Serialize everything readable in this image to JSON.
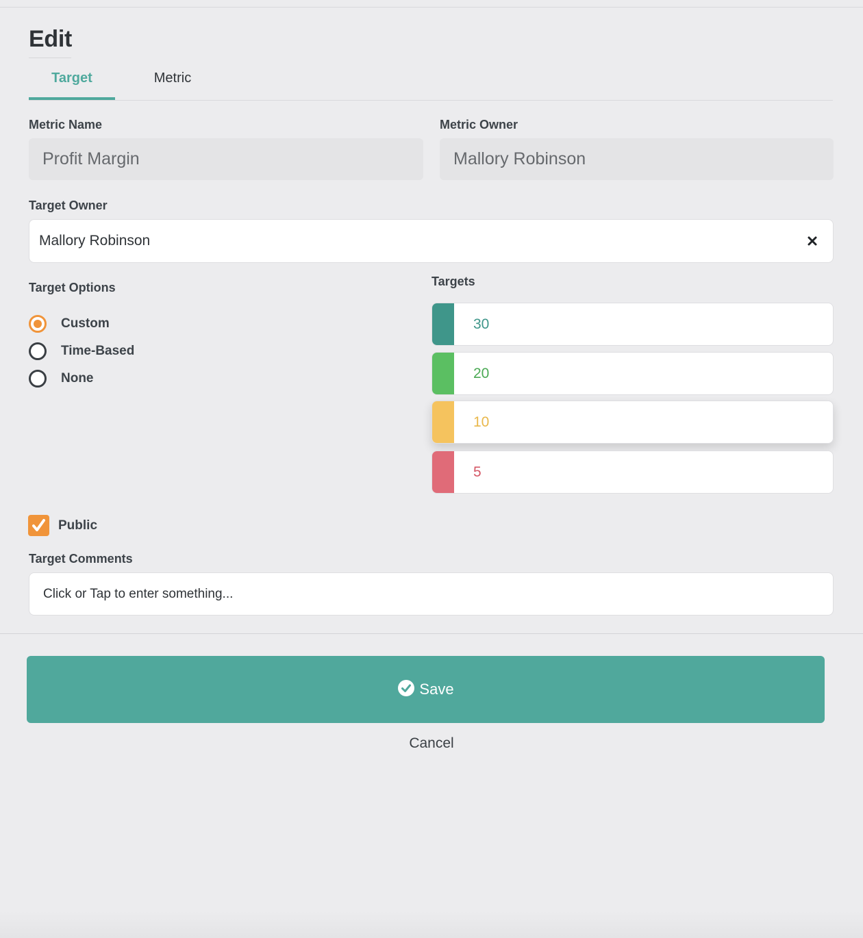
{
  "page": {
    "title": "Edit"
  },
  "tabs": [
    {
      "label": "Target",
      "active": true
    },
    {
      "label": "Metric",
      "active": false
    }
  ],
  "metric_name": {
    "label": "Metric Name",
    "value": "Profit Margin"
  },
  "metric_owner": {
    "label": "Metric Owner",
    "value": "Mallory Robinson"
  },
  "target_owner": {
    "label": "Target Owner",
    "value": "Mallory Robinson",
    "clear_icon": "close-icon"
  },
  "target_options": {
    "label": "Target Options",
    "options": [
      {
        "label": "Custom",
        "checked": true
      },
      {
        "label": "Time-Based",
        "checked": false
      },
      {
        "label": "None",
        "checked": false
      }
    ],
    "accent_color": "#f0943a"
  },
  "targets": {
    "label": "Targets",
    "items": [
      {
        "value": "30",
        "color": "#3f968a",
        "text_color": "#3f968a"
      },
      {
        "value": "20",
        "color": "#5bbf62",
        "text_color": "#4caa55"
      },
      {
        "value": "10",
        "color": "#f5c35e",
        "text_color": "#e9b84c"
      },
      {
        "value": "5",
        "color": "#e06b78",
        "text_color": "#d45766"
      }
    ]
  },
  "public": {
    "label": "Public",
    "checked": true
  },
  "target_comments": {
    "label": "Target Comments",
    "placeholder": "Click or Tap to enter something..."
  },
  "actions": {
    "save_label": "Save",
    "cancel_label": "Cancel",
    "save_color": "#50a89c"
  }
}
